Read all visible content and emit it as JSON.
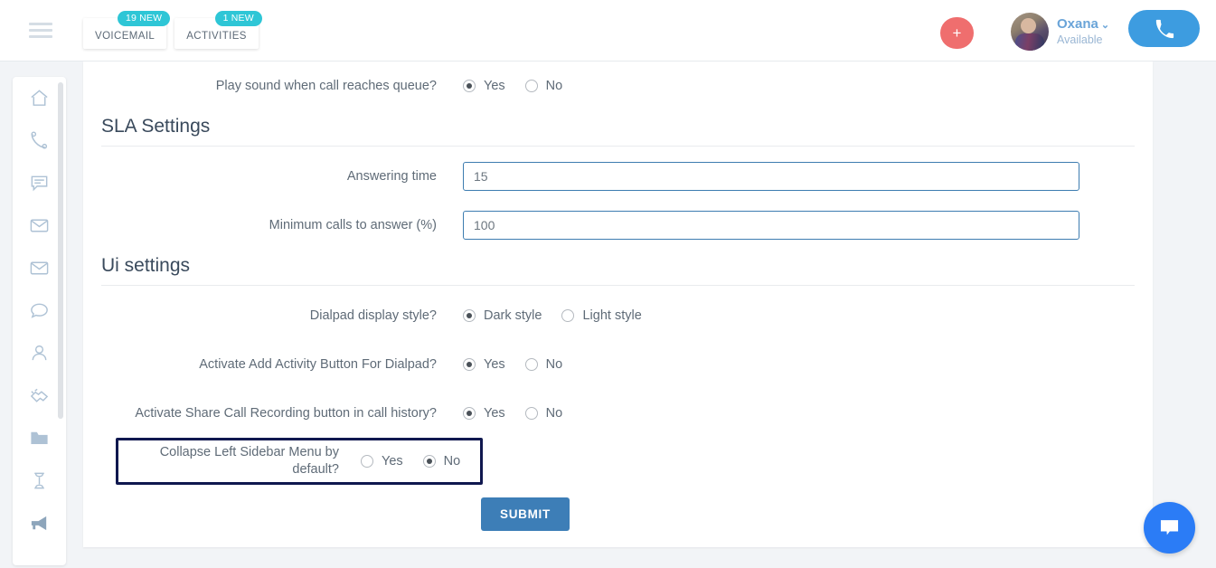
{
  "header": {
    "menu_icon": "hamburger-icon",
    "tabs": [
      {
        "label": "VOICEMAIL",
        "badge": "19 NEW"
      },
      {
        "label": "ACTIVITIES",
        "badge": "1 NEW"
      }
    ],
    "add_button_label": "+",
    "user": {
      "name": "Oxana",
      "caret": "⌄",
      "status": "Available"
    },
    "call_button_icon": "phone-icon",
    "badge_color": "#2ec6d6",
    "add_button_color": "#ef6e6e",
    "call_button_color": "#3d9ce0"
  },
  "sidebar": {
    "items": [
      {
        "icon": "home-icon"
      },
      {
        "icon": "phone-handset-icon"
      },
      {
        "icon": "comment-lines-icon"
      },
      {
        "icon": "envelope-icon"
      },
      {
        "icon": "envelope-open-icon"
      },
      {
        "icon": "speech-bubble-icon"
      },
      {
        "icon": "user-icon"
      },
      {
        "icon": "handshake-icon"
      },
      {
        "icon": "folder-icon"
      },
      {
        "icon": "hourglass-icon"
      },
      {
        "icon": "megaphone-icon"
      }
    ]
  },
  "main": {
    "top_row": {
      "label": "Play sound when call reaches queue?",
      "options": [
        {
          "label": "Yes",
          "selected": true
        },
        {
          "label": "No",
          "selected": false
        }
      ]
    },
    "sections": [
      {
        "title": "SLA Settings",
        "fields": [
          {
            "label": "Answering time",
            "value": "15"
          },
          {
            "label": "Minimum calls to answer (%)",
            "value": "100"
          }
        ]
      },
      {
        "title": "Ui settings",
        "rows": [
          {
            "label": "Dialpad display style?",
            "options": [
              {
                "label": "Dark style",
                "selected": true
              },
              {
                "label": "Light style",
                "selected": false
              }
            ]
          },
          {
            "label": "Activate Add Activity Button For Dialpad?",
            "options": [
              {
                "label": "Yes",
                "selected": true
              },
              {
                "label": "No",
                "selected": false
              }
            ]
          },
          {
            "label": "Activate Share Call Recording button in call history?",
            "options": [
              {
                "label": "Yes",
                "selected": true
              },
              {
                "label": "No",
                "selected": false
              }
            ]
          }
        ],
        "highlighted_row": {
          "label": "Collapse Left Sidebar Menu by default?",
          "options": [
            {
              "label": "Yes",
              "selected": false
            },
            {
              "label": "No",
              "selected": true
            }
          ],
          "highlight_color": "#10184f"
        }
      }
    ],
    "submit_label": "SUBMIT",
    "submit_color": "#3d7eb7",
    "input_border_color": "#3d7cb0"
  },
  "chat_widget": {
    "icon": "chat-bubble-icon",
    "color": "#2b7cf6"
  }
}
